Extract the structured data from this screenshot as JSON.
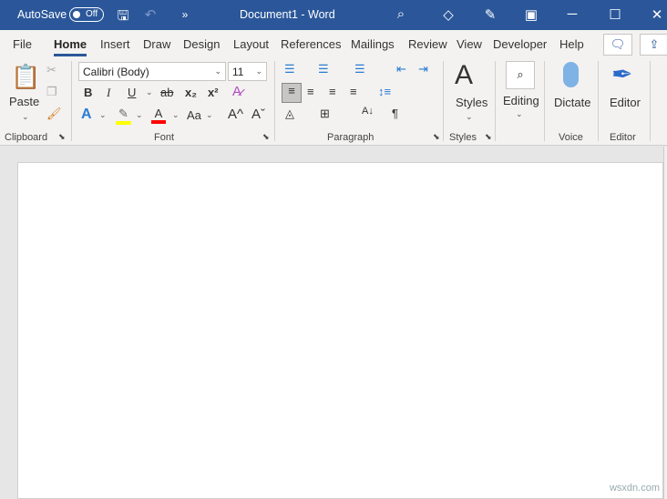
{
  "titlebar": {
    "autosave_label": "AutoSave",
    "autosave_state": "Off",
    "title": "Document1  -  Word",
    "more": "»"
  },
  "tabs": [
    "File",
    "Home",
    "Insert",
    "Draw",
    "Design",
    "Layout",
    "References",
    "Mailings",
    "Review",
    "View",
    "Developer",
    "Help"
  ],
  "ribbon": {
    "clipboard": {
      "paste": "Paste",
      "label": "Clipboard"
    },
    "font": {
      "name": "Calibri (Body)",
      "size": "11",
      "bold": "B",
      "italic": "I",
      "underline": "U",
      "strike": "ab",
      "sub": "x₂",
      "sup": "x²",
      "case": "Aa",
      "grow": "A^",
      "shrink": "Aˇ",
      "label": "Font"
    },
    "paragraph": {
      "label": "Paragraph",
      "pilcrow": "¶"
    },
    "styles": {
      "button": "Styles",
      "label": "Styles"
    },
    "editing": {
      "button": "Editing"
    },
    "voice": {
      "button": "Dictate",
      "label": "Voice"
    },
    "editor": {
      "button": "Editor",
      "label": "Editor"
    }
  },
  "colors": {
    "brand": "#2b579a",
    "highlight": "#ffff00",
    "font_color": "#ff0000"
  },
  "watermark": "wsxdn.com"
}
